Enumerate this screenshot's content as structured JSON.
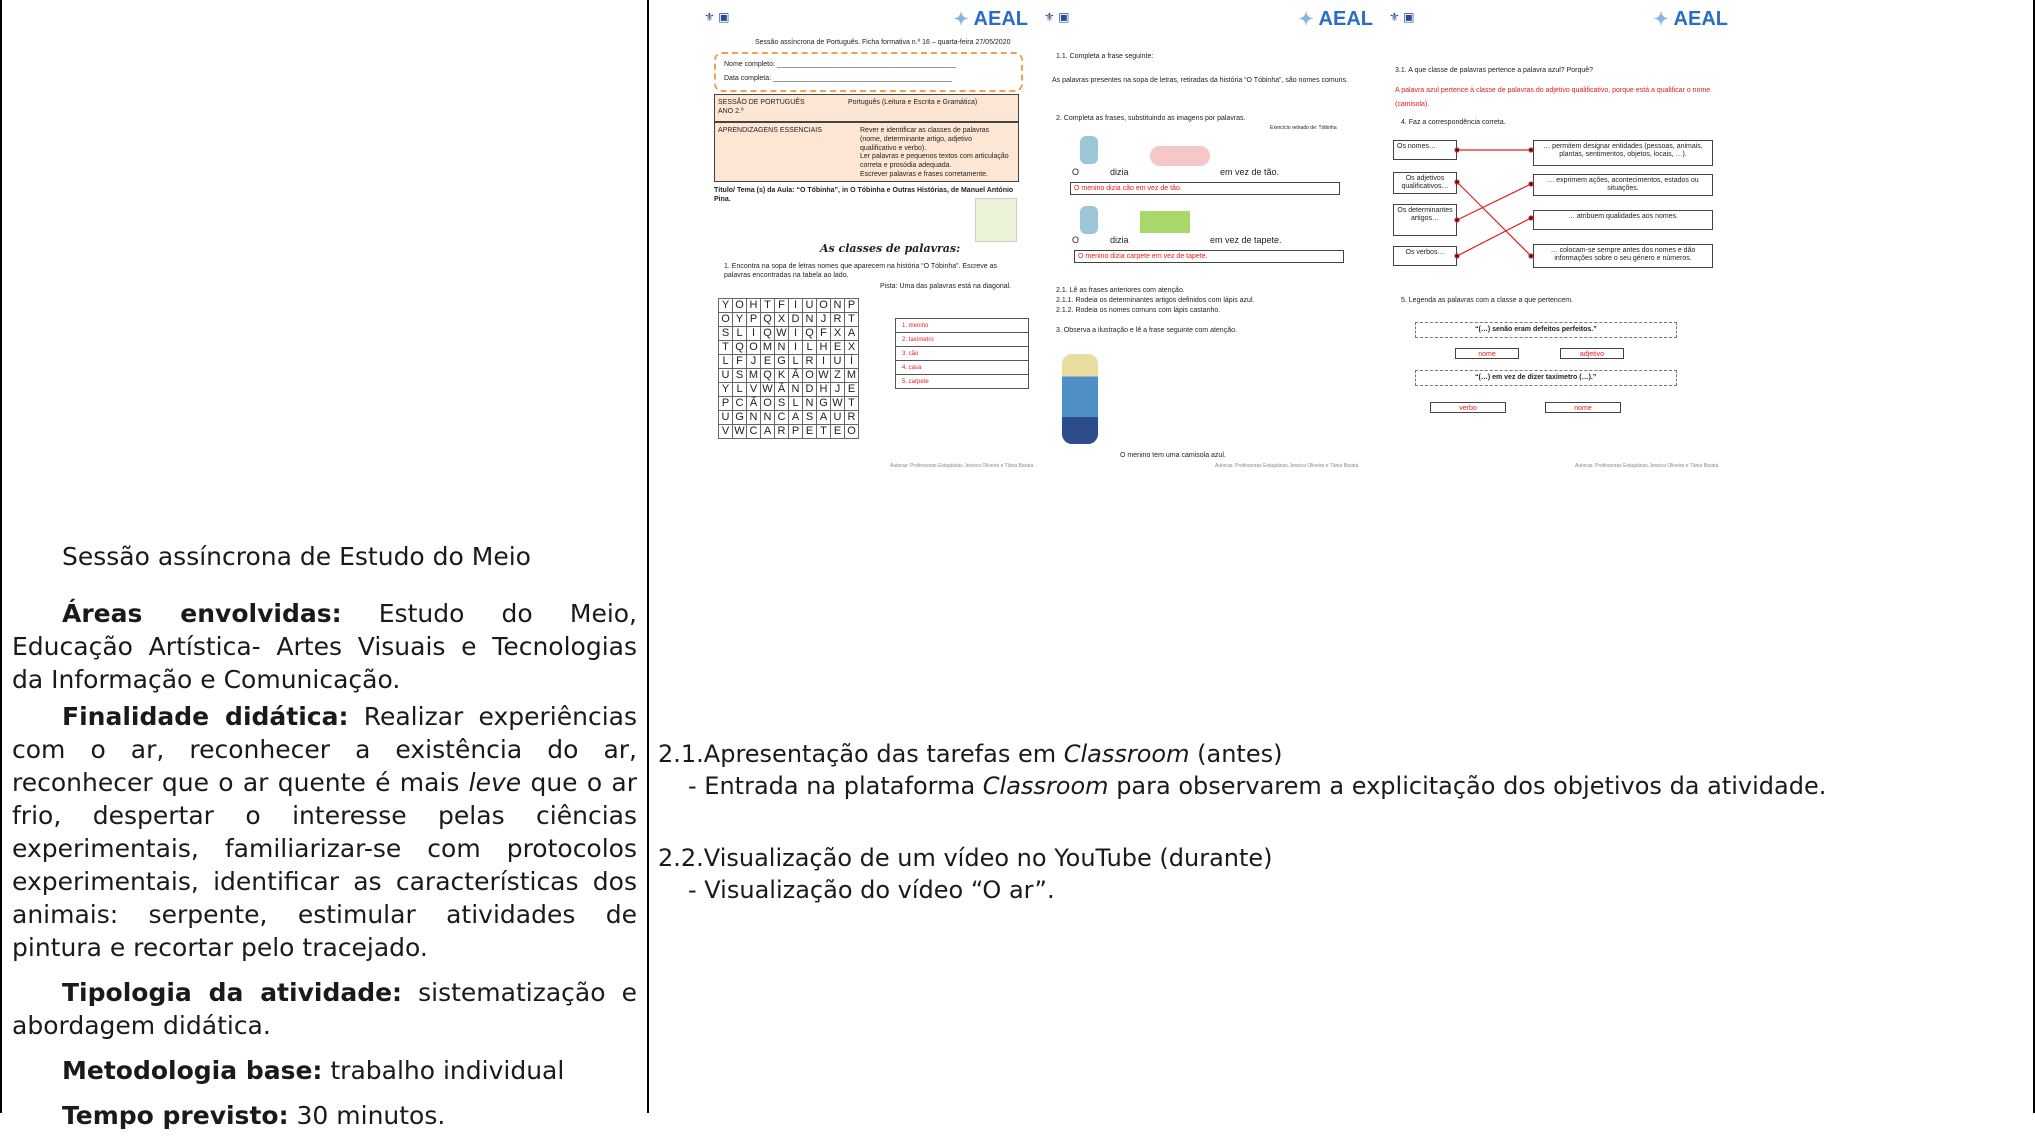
{
  "left_cell": {
    "heading": "Sessão assíncrona de Estudo do Meio",
    "areas_label": "Áreas envolvidas:",
    "areas_text": " Estudo do Meio, Educação Artística- Artes Visuais e Tecnologias da Informação e Comunicação.",
    "finalidade_label": "Finalidade didática:",
    "finalidade_text_1": " Realizar experiências com o ar, reconhecer a existência do ar, reconhecer que o ar quente é mais ",
    "finalidade_italic": "leve",
    "finalidade_text_2": " que o ar frio, despertar o interesse pelas ciências experimentais, familiarizar-se com protocolos experimentais, identificar as características dos animais: serpente, estimular atividades de pintura e recortar pelo tracejado.",
    "tipologia_label": "Tipologia da atividade:",
    "tipologia_text": " sistematização e abordagem didática.",
    "metodologia_label": "Metodologia base:",
    "metodologia_text": " trabalho individual",
    "tempo_label": "Tempo previsto:",
    "tempo_text": " 30 minutos."
  },
  "right_cell": {
    "item1_prefix": "2.1.Apresentação das tarefas em ",
    "item1_italic": "Classroom",
    "item1_suffix": " (antes)",
    "item1_sub_prefix": "- Entrada na plataforma ",
    "item1_sub_italic": "Classroom",
    "item1_sub_suffix": " para observarem a explicitação dos objetivos da atividade.",
    "item2": "2.2.Visualização de um vídeo no YouTube (durante)",
    "item2_sub": "- Visualização do vídeo “O ar”."
  },
  "thumbnails": {
    "brand": "AEAL",
    "page1": {
      "header": "Sessão assíncrona de Português. Ficha formativa n.º 16 – quarta-feira 27/05/2020",
      "name_label": "Nome completo: ______________________________________________",
      "date_label": "Data completa: ______________________________________________",
      "session": "SESSÃO DE PORTUGUÊS  ANO 2.º",
      "session_subject": "Português (Leitura e Escrita e Gramática)",
      "aprend_label": "APRENDIZAGENS ESSENCIAIS",
      "aprend_items": [
        "Rever e identificar as classes de palavras (nome, determinante artigo, adjetivo qualificativo e verbo).",
        "Ler palavras e pequenos textos com articulação correta e prosódia adequada.",
        "Escrever palavras e frases corretamente."
      ],
      "title_line": "Título/ Tema (s) da Aula: “O Tóbinha”, in O Tóbinha e Outras Histórias, de Manuel António Pina.",
      "section_title": "As classes de palavras:",
      "q1": "1. Encontra na sopa de letras nomes que aparecem na história “O Tóbinha”. Escreve as palavras encontradas na tabela ao lado.",
      "hint": "Pista: Uma das palavras está na diagonal.",
      "grid": [
        "YOHTFIUONP",
        "OYPQXDNJRT",
        "SLIQWIQFXA",
        "TQOMNILHEX",
        "LFJEGLRIUÍ",
        "USMQKÃOWZM",
        "YLVWÃNDHJE",
        "PCÃOSLNGWT",
        "UGNNCASAUR",
        "VWCARPETEO"
      ],
      "answers": [
        "1. menino",
        "2. taxímetro",
        "3. cão",
        "4. casa",
        "5. carpete"
      ],
      "footer": "Autoras: Professoras Estagiárias Jessica Oliveira e Tânia Barata"
    },
    "page2": {
      "q11": "1.1. Completa a frase seguinte:",
      "q11_text": "As palavras presentes na sopa de letras, retiradas da história “O Tóbinha”, são nomes comuns.",
      "q2": "2. Completa as frases, substituindo as imagens por palavras.",
      "q2_source": "Exercício retirado de: Tóbinha",
      "s1_a": "O",
      "s1_b": "dizia",
      "s1_c": "em vez de tão.",
      "s1_answer": "O menino dizia cão em vez de tão.",
      "s2_c": "em vez de tapete.",
      "s2_answer": "O menino dizia carpete em vez de tapete.",
      "q21": "2.1.     Lê as frases anteriores com atenção.",
      "q211": "2.1.1.  Rodeia os determinantes artigos definidos com lápis azul.",
      "q212": "2.1.2.  Rodeia os nomes comuns com lápis castanho.",
      "q3": "3. Observa a ilustração e lê a frase seguinte com atenção.",
      "caption": "O menino tem uma camisola azul.",
      "footer": "Autoras: Professoras Estagiárias Jessica Oliveira e Tânia Barata"
    },
    "page3": {
      "q31": "3.1. A que classe de palavras pertence a palavra azul? Porquê?",
      "q31_answer": "A palavra azul pertence à classe de palavras do adjetivo qualificativo, porque está a qualificar o nome (camisola).",
      "q4": "4. Faz a correspondência correta.",
      "left_boxes": [
        "Os nomes…",
        "Os adjetivos qualificativos…",
        "Os determinantes artigos…",
        "Os verbos…"
      ],
      "right_boxes": [
        "… permitem designar entidades (pessoas, animais, plantas, sentimentos, objetos, locais, …).",
        "… exprimem ações, acontecimentos, estados ou situações.",
        "… atribuem qualidades aos nomes.",
        "… colocam-se sempre antes dos nomes e dão informações sobre o seu género e números."
      ],
      "q5": "5. Legenda as palavras com a classe a que pertencem.",
      "phrase1": "“(…) senão eram defeitos perfeitos.”",
      "labels1": [
        "nome",
        "adjetivo"
      ],
      "phrase2": "“(…) em vez de dizer taxímetro (…).”",
      "labels2": [
        "verbo",
        "nome"
      ],
      "footer": "Autoras: Professoras Estagiárias Jessica Oliveira e Tânia Barata"
    }
  }
}
